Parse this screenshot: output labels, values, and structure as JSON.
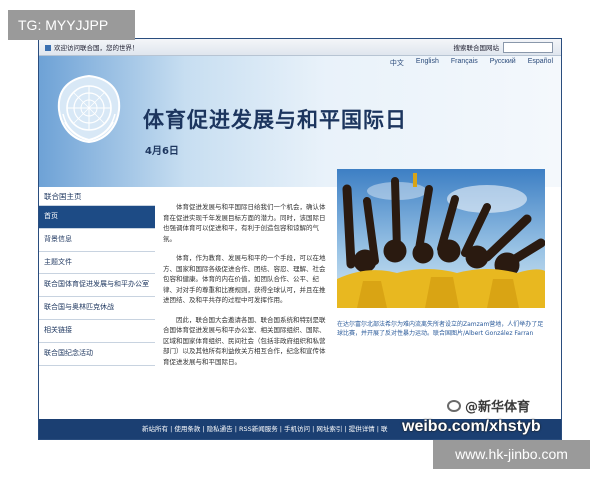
{
  "overlay": {
    "top_badge": "TG: MYYJJPP",
    "bottom_badge": "www.hk-jinbo.com"
  },
  "topbar": {
    "welcome": "欢迎访问联合国，您的世界！",
    "search_label": "搜索联合国网站"
  },
  "languages": [
    "中文",
    "English",
    "Français",
    "Русский",
    "Español"
  ],
  "header": {
    "title": "体育促进发展与和平国际日",
    "date": "4月6日"
  },
  "sidebar": {
    "top_link": "联合国主页",
    "items": [
      {
        "label": "首页",
        "active": true
      },
      {
        "label": "背景信息",
        "active": false
      },
      {
        "label": "主题文件",
        "active": false
      },
      {
        "label": "联合国体育促进发展与和平办公室",
        "active": false
      },
      {
        "label": "联合国与奥林匹克休战",
        "active": false
      },
      {
        "label": "相关链接",
        "active": false
      },
      {
        "label": "联合国纪念活动",
        "active": false
      }
    ]
  },
  "content": {
    "paragraphs": [
      "体育促进发展与和平国际日给我们一个机会，确认体育在促进实现千年发展目标方面的潜力。同时，该国际日也强调体育可以促进和平，有利于创造包容和谅解的气氛。",
      "体育，作为教育、发展与和平的一个手段，可以在地方、国家和国际各级促进合作、团结、容忍、理解、社会包容和健康。体育的内在价值，如团队合作、公平、纪律、对对手的尊重和比赛规则，获得全球认可，并且在推进团结、及和平共存的过程中可发挥作用。",
      "因此，联合国大会邀请各国、联合国系统和特别是联合国体育促进发展与和平办公室、相关国际组织、国际、区域和国家体育组织、民间社会（包括非政府组织和私营部门）以及其他所有利益攸关方相互合作，纪念和宣传体育促进发展与和平国际日。"
    ],
    "photo_caption": "在达尔富尔北部法希尔为难内流离失所者设立的Zamzam营地，人们举办了足球比赛，并开展了反对性暴力运动。联合国图片/Albert González Farran"
  },
  "footer": {
    "links": "新站所有 | 使用条款 | 隐私通告 | RSS新闻服务 | 手机访问 | 网址索引 | 提供详情 | 联"
  },
  "watermark": {
    "weibo_name": "@新华体育",
    "weibo_url": "weibo.com/xhstyb"
  },
  "colors": {
    "un_blue": "#1d4b85",
    "title_navy": "#1c355e",
    "header_light": "#e9f2fa",
    "football_shirt_yellow": "#e8b820",
    "overlay_gray": "#9a9a9a"
  }
}
